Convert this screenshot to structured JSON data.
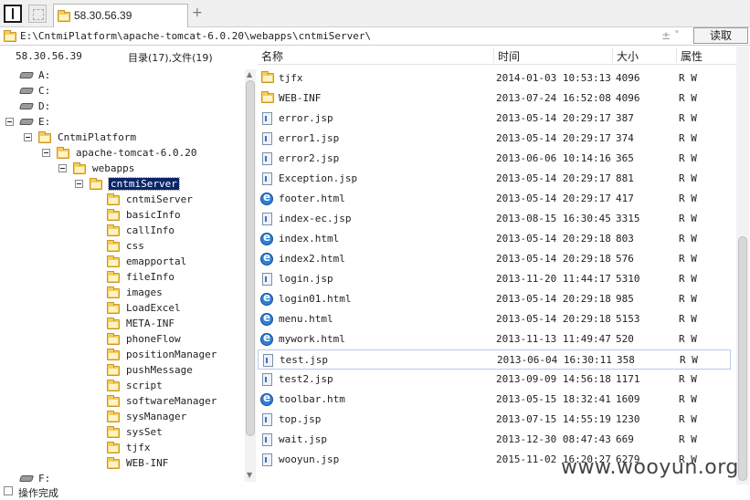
{
  "tabbar": {
    "tab_title": "58.30.56.39",
    "add_tab": "+"
  },
  "address": {
    "path": "E:\\CntmiPlatform\\apache-tomcat-6.0.20\\webapps\\cntmiServer\\",
    "controls": "± ˅",
    "read_button": "读取"
  },
  "left_header": {
    "host": "58.30.56.39",
    "summary": "目录(17),文件(19)"
  },
  "tree": {
    "drives": [
      "A:",
      "C:",
      "D:",
      "E:"
    ],
    "level1": "CntmiPlatform",
    "level2": "apache-tomcat-6.0.20",
    "level3": "webapps",
    "selected": "cntmiServer",
    "children": [
      "cntmiServer",
      "basicInfo",
      "callInfo",
      "css",
      "emapportal",
      "fileInfo",
      "images",
      "LoadExcel",
      "META-INF",
      "phoneFlow",
      "positionManager",
      "pushMessage",
      "script",
      "softwareManager",
      "sysManager",
      "sysSet",
      "tjfx",
      "WEB-INF"
    ],
    "drive_f": "F:"
  },
  "columns": {
    "name": "名称",
    "time": "时间",
    "size": "大小",
    "attr": "属性"
  },
  "files": [
    {
      "type": "folder",
      "name": "tjfx",
      "time": "2014-01-03 10:53:13",
      "size": "4096",
      "attr": "R W"
    },
    {
      "type": "folder",
      "name": "WEB-INF",
      "time": "2013-07-24 16:52:08",
      "size": "4096",
      "attr": "R W"
    },
    {
      "type": "jsp",
      "name": "error.jsp",
      "time": "2013-05-14 20:29:17",
      "size": "387",
      "attr": "R W"
    },
    {
      "type": "jsp",
      "name": "error1.jsp",
      "time": "2013-05-14 20:29:17",
      "size": "374",
      "attr": "R W"
    },
    {
      "type": "jsp",
      "name": "error2.jsp",
      "time": "2013-06-06 10:14:16",
      "size": "365",
      "attr": "R W"
    },
    {
      "type": "jsp",
      "name": "Exception.jsp",
      "time": "2013-05-14 20:29:17",
      "size": "881",
      "attr": "R W"
    },
    {
      "type": "html",
      "name": "footer.html",
      "time": "2013-05-14 20:29:17",
      "size": "417",
      "attr": "R W"
    },
    {
      "type": "jsp",
      "name": "index-ec.jsp",
      "time": "2013-08-15 16:30:45",
      "size": "3315",
      "attr": "R W"
    },
    {
      "type": "html",
      "name": "index.html",
      "time": "2013-05-14 20:29:18",
      "size": "803",
      "attr": "R W"
    },
    {
      "type": "html",
      "name": "index2.html",
      "time": "2013-05-14 20:29:18",
      "size": "576",
      "attr": "R W"
    },
    {
      "type": "jsp",
      "name": "login.jsp",
      "time": "2013-11-20 11:44:17",
      "size": "5310",
      "attr": "R W"
    },
    {
      "type": "html",
      "name": "login01.html",
      "time": "2013-05-14 20:29:18",
      "size": "985",
      "attr": "R W"
    },
    {
      "type": "html",
      "name": "menu.html",
      "time": "2013-05-14 20:29:18",
      "size": "5153",
      "attr": "R W"
    },
    {
      "type": "html",
      "name": "mywork.html",
      "time": "2013-11-13 11:49:47",
      "size": "520",
      "attr": "R W"
    },
    {
      "type": "jsp",
      "name": "test.jsp",
      "time": "2013-06-04 16:30:11",
      "size": "358",
      "attr": "R W"
    },
    {
      "type": "jsp",
      "name": "test2.jsp",
      "time": "2013-09-09 14:56:18",
      "size": "1171",
      "attr": "R W"
    },
    {
      "type": "html",
      "name": "toolbar.htm",
      "time": "2013-05-15 18:32:41",
      "size": "1609",
      "attr": "R W"
    },
    {
      "type": "jsp",
      "name": "top.jsp",
      "time": "2013-07-15 14:55:19",
      "size": "1230",
      "attr": "R W"
    },
    {
      "type": "jsp",
      "name": "wait.jsp",
      "time": "2013-12-30 08:47:43",
      "size": "669",
      "attr": "R W"
    },
    {
      "type": "jsp",
      "name": "wooyun.jsp",
      "time": "2015-11-02 16:20:27",
      "size": "6279",
      "attr": "R W"
    }
  ],
  "status": {
    "text": "操作完成"
  },
  "watermark": "www.wooyun.org"
}
